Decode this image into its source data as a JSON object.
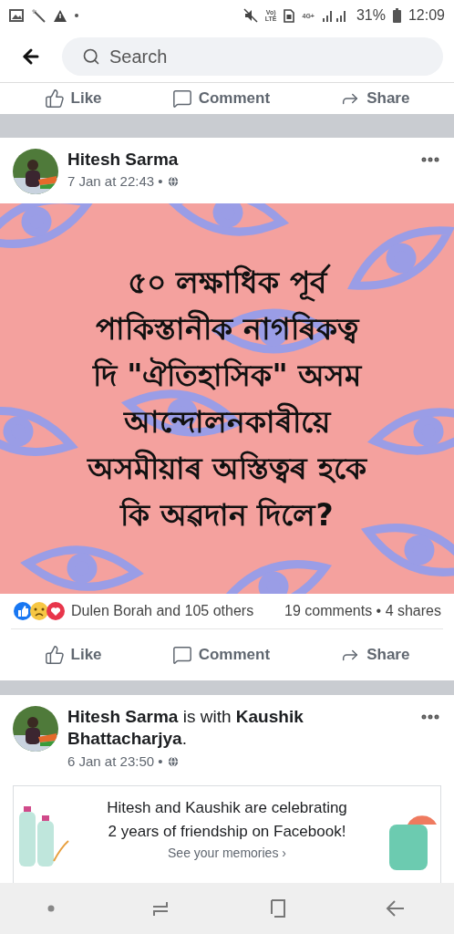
{
  "status_bar": {
    "volte": [
      "Vo)",
      "LTE"
    ],
    "network": "4G+",
    "battery": "31%",
    "time": "12:09"
  },
  "header": {
    "search": {
      "placeholder": "Search"
    }
  },
  "top_actions": [
    "Like",
    "Comment",
    "Share"
  ],
  "posts": [
    {
      "kind": "image_post",
      "author": "Hitesh Sarma",
      "date": "7 Jan at 22:43 •",
      "image_text_lines": [
        "৫০ লক্ষাধিক পূৰ্ব",
        "পাকিস্তানীক নাগৰিকত্ব",
        "দি \"ঐতিহাসিক\" অসম",
        "আন্দোলনকাৰীয়ে",
        "অসমীয়াৰ অস্তিত্বৰ হকে",
        "কি অৱদান দিলে?"
      ],
      "reactions": "Dulen Borah and 105 others",
      "comments": "19 comments • 4 shares",
      "actions": [
        "Like",
        "Comment",
        "Share"
      ]
    },
    {
      "kind": "memory_post",
      "author_line": "**Hitesh Sarma** is with **Kaushik Bhattacharjya**.",
      "date": "6 Jan at 23:50 •",
      "memory_lines": [
        "Hitesh and Kaushik are celebrating",
        "2 years of friendship on Facebook!"
      ],
      "memory_link": "See your memories ›"
    }
  ]
}
